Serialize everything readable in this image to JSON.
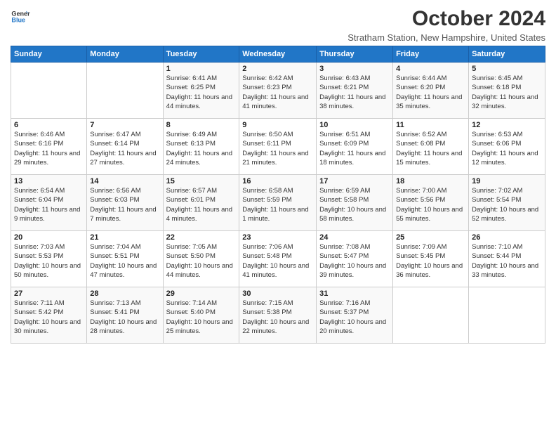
{
  "logo": {
    "line1": "General",
    "line2": "Blue"
  },
  "title": "October 2024",
  "location": "Stratham Station, New Hampshire, United States",
  "days_header": [
    "Sunday",
    "Monday",
    "Tuesday",
    "Wednesday",
    "Thursday",
    "Friday",
    "Saturday"
  ],
  "weeks": [
    [
      {
        "day": "",
        "sunrise": "",
        "sunset": "",
        "daylight": ""
      },
      {
        "day": "",
        "sunrise": "",
        "sunset": "",
        "daylight": ""
      },
      {
        "day": "1",
        "sunrise": "Sunrise: 6:41 AM",
        "sunset": "Sunset: 6:25 PM",
        "daylight": "Daylight: 11 hours and 44 minutes."
      },
      {
        "day": "2",
        "sunrise": "Sunrise: 6:42 AM",
        "sunset": "Sunset: 6:23 PM",
        "daylight": "Daylight: 11 hours and 41 minutes."
      },
      {
        "day": "3",
        "sunrise": "Sunrise: 6:43 AM",
        "sunset": "Sunset: 6:21 PM",
        "daylight": "Daylight: 11 hours and 38 minutes."
      },
      {
        "day": "4",
        "sunrise": "Sunrise: 6:44 AM",
        "sunset": "Sunset: 6:20 PM",
        "daylight": "Daylight: 11 hours and 35 minutes."
      },
      {
        "day": "5",
        "sunrise": "Sunrise: 6:45 AM",
        "sunset": "Sunset: 6:18 PM",
        "daylight": "Daylight: 11 hours and 32 minutes."
      }
    ],
    [
      {
        "day": "6",
        "sunrise": "Sunrise: 6:46 AM",
        "sunset": "Sunset: 6:16 PM",
        "daylight": "Daylight: 11 hours and 29 minutes."
      },
      {
        "day": "7",
        "sunrise": "Sunrise: 6:47 AM",
        "sunset": "Sunset: 6:14 PM",
        "daylight": "Daylight: 11 hours and 27 minutes."
      },
      {
        "day": "8",
        "sunrise": "Sunrise: 6:49 AM",
        "sunset": "Sunset: 6:13 PM",
        "daylight": "Daylight: 11 hours and 24 minutes."
      },
      {
        "day": "9",
        "sunrise": "Sunrise: 6:50 AM",
        "sunset": "Sunset: 6:11 PM",
        "daylight": "Daylight: 11 hours and 21 minutes."
      },
      {
        "day": "10",
        "sunrise": "Sunrise: 6:51 AM",
        "sunset": "Sunset: 6:09 PM",
        "daylight": "Daylight: 11 hours and 18 minutes."
      },
      {
        "day": "11",
        "sunrise": "Sunrise: 6:52 AM",
        "sunset": "Sunset: 6:08 PM",
        "daylight": "Daylight: 11 hours and 15 minutes."
      },
      {
        "day": "12",
        "sunrise": "Sunrise: 6:53 AM",
        "sunset": "Sunset: 6:06 PM",
        "daylight": "Daylight: 11 hours and 12 minutes."
      }
    ],
    [
      {
        "day": "13",
        "sunrise": "Sunrise: 6:54 AM",
        "sunset": "Sunset: 6:04 PM",
        "daylight": "Daylight: 11 hours and 9 minutes."
      },
      {
        "day": "14",
        "sunrise": "Sunrise: 6:56 AM",
        "sunset": "Sunset: 6:03 PM",
        "daylight": "Daylight: 11 hours and 7 minutes."
      },
      {
        "day": "15",
        "sunrise": "Sunrise: 6:57 AM",
        "sunset": "Sunset: 6:01 PM",
        "daylight": "Daylight: 11 hours and 4 minutes."
      },
      {
        "day": "16",
        "sunrise": "Sunrise: 6:58 AM",
        "sunset": "Sunset: 5:59 PM",
        "daylight": "Daylight: 11 hours and 1 minute."
      },
      {
        "day": "17",
        "sunrise": "Sunrise: 6:59 AM",
        "sunset": "Sunset: 5:58 PM",
        "daylight": "Daylight: 10 hours and 58 minutes."
      },
      {
        "day": "18",
        "sunrise": "Sunrise: 7:00 AM",
        "sunset": "Sunset: 5:56 PM",
        "daylight": "Daylight: 10 hours and 55 minutes."
      },
      {
        "day": "19",
        "sunrise": "Sunrise: 7:02 AM",
        "sunset": "Sunset: 5:54 PM",
        "daylight": "Daylight: 10 hours and 52 minutes."
      }
    ],
    [
      {
        "day": "20",
        "sunrise": "Sunrise: 7:03 AM",
        "sunset": "Sunset: 5:53 PM",
        "daylight": "Daylight: 10 hours and 50 minutes."
      },
      {
        "day": "21",
        "sunrise": "Sunrise: 7:04 AM",
        "sunset": "Sunset: 5:51 PM",
        "daylight": "Daylight: 10 hours and 47 minutes."
      },
      {
        "day": "22",
        "sunrise": "Sunrise: 7:05 AM",
        "sunset": "Sunset: 5:50 PM",
        "daylight": "Daylight: 10 hours and 44 minutes."
      },
      {
        "day": "23",
        "sunrise": "Sunrise: 7:06 AM",
        "sunset": "Sunset: 5:48 PM",
        "daylight": "Daylight: 10 hours and 41 minutes."
      },
      {
        "day": "24",
        "sunrise": "Sunrise: 7:08 AM",
        "sunset": "Sunset: 5:47 PM",
        "daylight": "Daylight: 10 hours and 39 minutes."
      },
      {
        "day": "25",
        "sunrise": "Sunrise: 7:09 AM",
        "sunset": "Sunset: 5:45 PM",
        "daylight": "Daylight: 10 hours and 36 minutes."
      },
      {
        "day": "26",
        "sunrise": "Sunrise: 7:10 AM",
        "sunset": "Sunset: 5:44 PM",
        "daylight": "Daylight: 10 hours and 33 minutes."
      }
    ],
    [
      {
        "day": "27",
        "sunrise": "Sunrise: 7:11 AM",
        "sunset": "Sunset: 5:42 PM",
        "daylight": "Daylight: 10 hours and 30 minutes."
      },
      {
        "day": "28",
        "sunrise": "Sunrise: 7:13 AM",
        "sunset": "Sunset: 5:41 PM",
        "daylight": "Daylight: 10 hours and 28 minutes."
      },
      {
        "day": "29",
        "sunrise": "Sunrise: 7:14 AM",
        "sunset": "Sunset: 5:40 PM",
        "daylight": "Daylight: 10 hours and 25 minutes."
      },
      {
        "day": "30",
        "sunrise": "Sunrise: 7:15 AM",
        "sunset": "Sunset: 5:38 PM",
        "daylight": "Daylight: 10 hours and 22 minutes."
      },
      {
        "day": "31",
        "sunrise": "Sunrise: 7:16 AM",
        "sunset": "Sunset: 5:37 PM",
        "daylight": "Daylight: 10 hours and 20 minutes."
      },
      {
        "day": "",
        "sunrise": "",
        "sunset": "",
        "daylight": ""
      },
      {
        "day": "",
        "sunrise": "",
        "sunset": "",
        "daylight": ""
      }
    ]
  ]
}
